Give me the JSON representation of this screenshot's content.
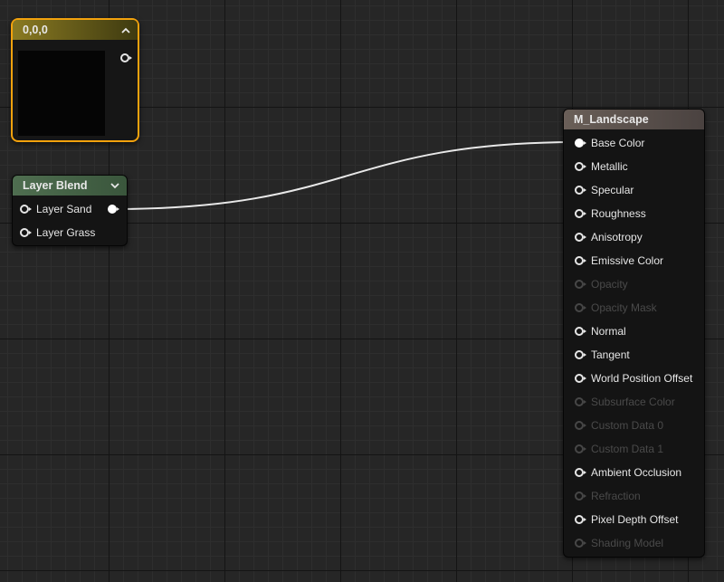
{
  "constant_node": {
    "title": "0,0,0",
    "preview_color": "#050505",
    "header_color": "#8a7a22",
    "selection_color": "#f2a20d",
    "collapse_icon": "chevron-up-icon"
  },
  "layer_blend_node": {
    "title": "Layer Blend",
    "header_color": "#4f6e50",
    "expand_icon": "chevron-down-icon",
    "inputs": [
      {
        "label": "Layer Sand",
        "connected": true
      },
      {
        "label": "Layer Grass",
        "connected": false
      }
    ]
  },
  "material_node": {
    "title": "M_Landscape",
    "header_color": "#6a5f58",
    "inputs": [
      {
        "label": "Base Color",
        "enabled": true,
        "connected": true
      },
      {
        "label": "Metallic",
        "enabled": true,
        "connected": false
      },
      {
        "label": "Specular",
        "enabled": true,
        "connected": false
      },
      {
        "label": "Roughness",
        "enabled": true,
        "connected": false
      },
      {
        "label": "Anisotropy",
        "enabled": true,
        "connected": false
      },
      {
        "label": "Emissive Color",
        "enabled": true,
        "connected": false
      },
      {
        "label": "Opacity",
        "enabled": false,
        "connected": false
      },
      {
        "label": "Opacity Mask",
        "enabled": false,
        "connected": false
      },
      {
        "label": "Normal",
        "enabled": true,
        "connected": false
      },
      {
        "label": "Tangent",
        "enabled": true,
        "connected": false
      },
      {
        "label": "World Position Offset",
        "enabled": true,
        "connected": false
      },
      {
        "label": "Subsurface Color",
        "enabled": false,
        "connected": false
      },
      {
        "label": "Custom Data 0",
        "enabled": false,
        "connected": false
      },
      {
        "label": "Custom Data 1",
        "enabled": false,
        "connected": false
      },
      {
        "label": "Ambient Occlusion",
        "enabled": true,
        "connected": false
      },
      {
        "label": "Refraction",
        "enabled": false,
        "connected": false
      },
      {
        "label": "Pixel Depth Offset",
        "enabled": true,
        "connected": false
      },
      {
        "label": "Shading Model",
        "enabled": false,
        "connected": false
      }
    ]
  },
  "wire": {
    "from": "Layer Blend",
    "to": "Base Color",
    "color": "#e8e8e8"
  }
}
